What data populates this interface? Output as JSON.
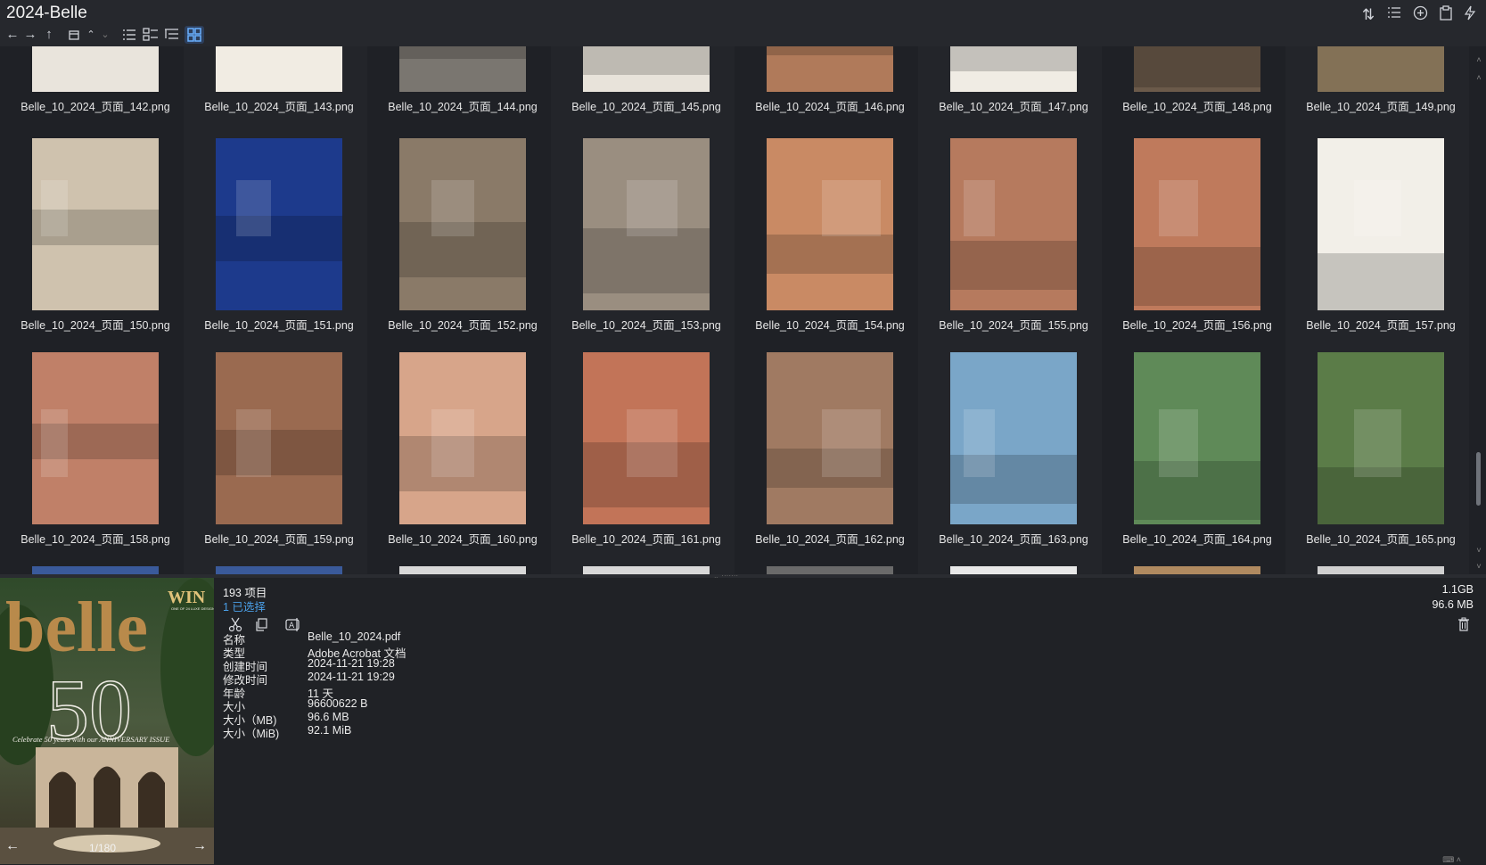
{
  "window": {
    "title": "2024-Belle"
  },
  "toolbar": {
    "back_icon": "arrow-left-icon",
    "forward_icon": "arrow-right-icon",
    "up_icon": "arrow-up-icon",
    "right_icons": [
      "sort-icon",
      "list-details-icon",
      "add-circle-icon",
      "clipboard-icon",
      "lightning-icon"
    ]
  },
  "grid": {
    "rows": [
      {
        "files": [
          "Belle_10_2024_页面_142.png",
          "Belle_10_2024_页面_143.png",
          "Belle_10_2024_页面_144.png",
          "Belle_10_2024_页面_145.png",
          "Belle_10_2024_页面_146.png",
          "Belle_10_2024_页面_147.png",
          "Belle_10_2024_页面_148.png",
          "Belle_10_2024_页面_149.png"
        ]
      },
      {
        "files": [
          "Belle_10_2024_页面_150.png",
          "Belle_10_2024_页面_151.png",
          "Belle_10_2024_页面_152.png",
          "Belle_10_2024_页面_153.png",
          "Belle_10_2024_页面_154.png",
          "Belle_10_2024_页面_155.png",
          "Belle_10_2024_页面_156.png",
          "Belle_10_2024_页面_157.png"
        ]
      },
      {
        "files": [
          "Belle_10_2024_页面_158.png",
          "Belle_10_2024_页面_159.png",
          "Belle_10_2024_页面_160.png",
          "Belle_10_2024_页面_161.png",
          "Belle_10_2024_页面_162.png",
          "Belle_10_2024_页面_163.png",
          "Belle_10_2024_页面_164.png",
          "Belle_10_2024_页面_165.png"
        ]
      }
    ],
    "thumb_colors": [
      [
        "#e9e4dc",
        "#f1ece3",
        "#7a7670",
        "#e8e3da",
        "#b07a5a",
        "#f0ece4",
        "#6b5a4a",
        "#a08a6a"
      ],
      [
        "#cfc2ae",
        "#1d3a8c",
        "#8a7a68",
        "#9a8e80",
        "#c98a64",
        "#b67a5e",
        "#bf7a5c",
        "#f2efe8"
      ],
      [
        "#c08068",
        "#9a6a50",
        "#d7a58a",
        "#c27458",
        "#a07a62",
        "#7aa6c8",
        "#5f8a58",
        "#5b7c48"
      ]
    ],
    "peek_colors": [
      "#3a5a9a",
      "#3a5a9a",
      "#d8d8d8",
      "#d8d8d8",
      "#6a6a6a",
      "#e8e8e8",
      "#b08a60",
      "#d0d0d0"
    ]
  },
  "details": {
    "item_count": "193 项目",
    "selected": "1 已选择",
    "size_total": "1.1GB",
    "size_selected": "96.6 MB",
    "actions": [
      "cut-icon",
      "copy-icon",
      "rename-icon"
    ],
    "properties": [
      {
        "key": "名称",
        "value": "Belle_10_2024.pdf"
      },
      {
        "key": "类型",
        "value": "Adobe Acrobat 文档"
      },
      {
        "key": "创建时间",
        "value": "2024-11-21   19:28"
      },
      {
        "key": "修改时间",
        "value": "2024-11-21   19:29"
      },
      {
        "key": "年龄",
        "value": "11 天"
      },
      {
        "key": "大小",
        "value": "96600622 B"
      },
      {
        "key": "大小（MB)",
        "value": "96.6 MB"
      },
      {
        "key": "大小（MiB)",
        "value": "92.1 MiB"
      }
    ]
  },
  "preview": {
    "page_counter": "1/180",
    "cover_brand": "belle",
    "cover_number": "50",
    "cover_badge": "WIN",
    "cover_badge_sub": "ONE OF 24 LUXE DESIGN PRIZES",
    "cover_tagline": "Celebrate 50 years with our ANNIVERSARY ISSUE"
  }
}
